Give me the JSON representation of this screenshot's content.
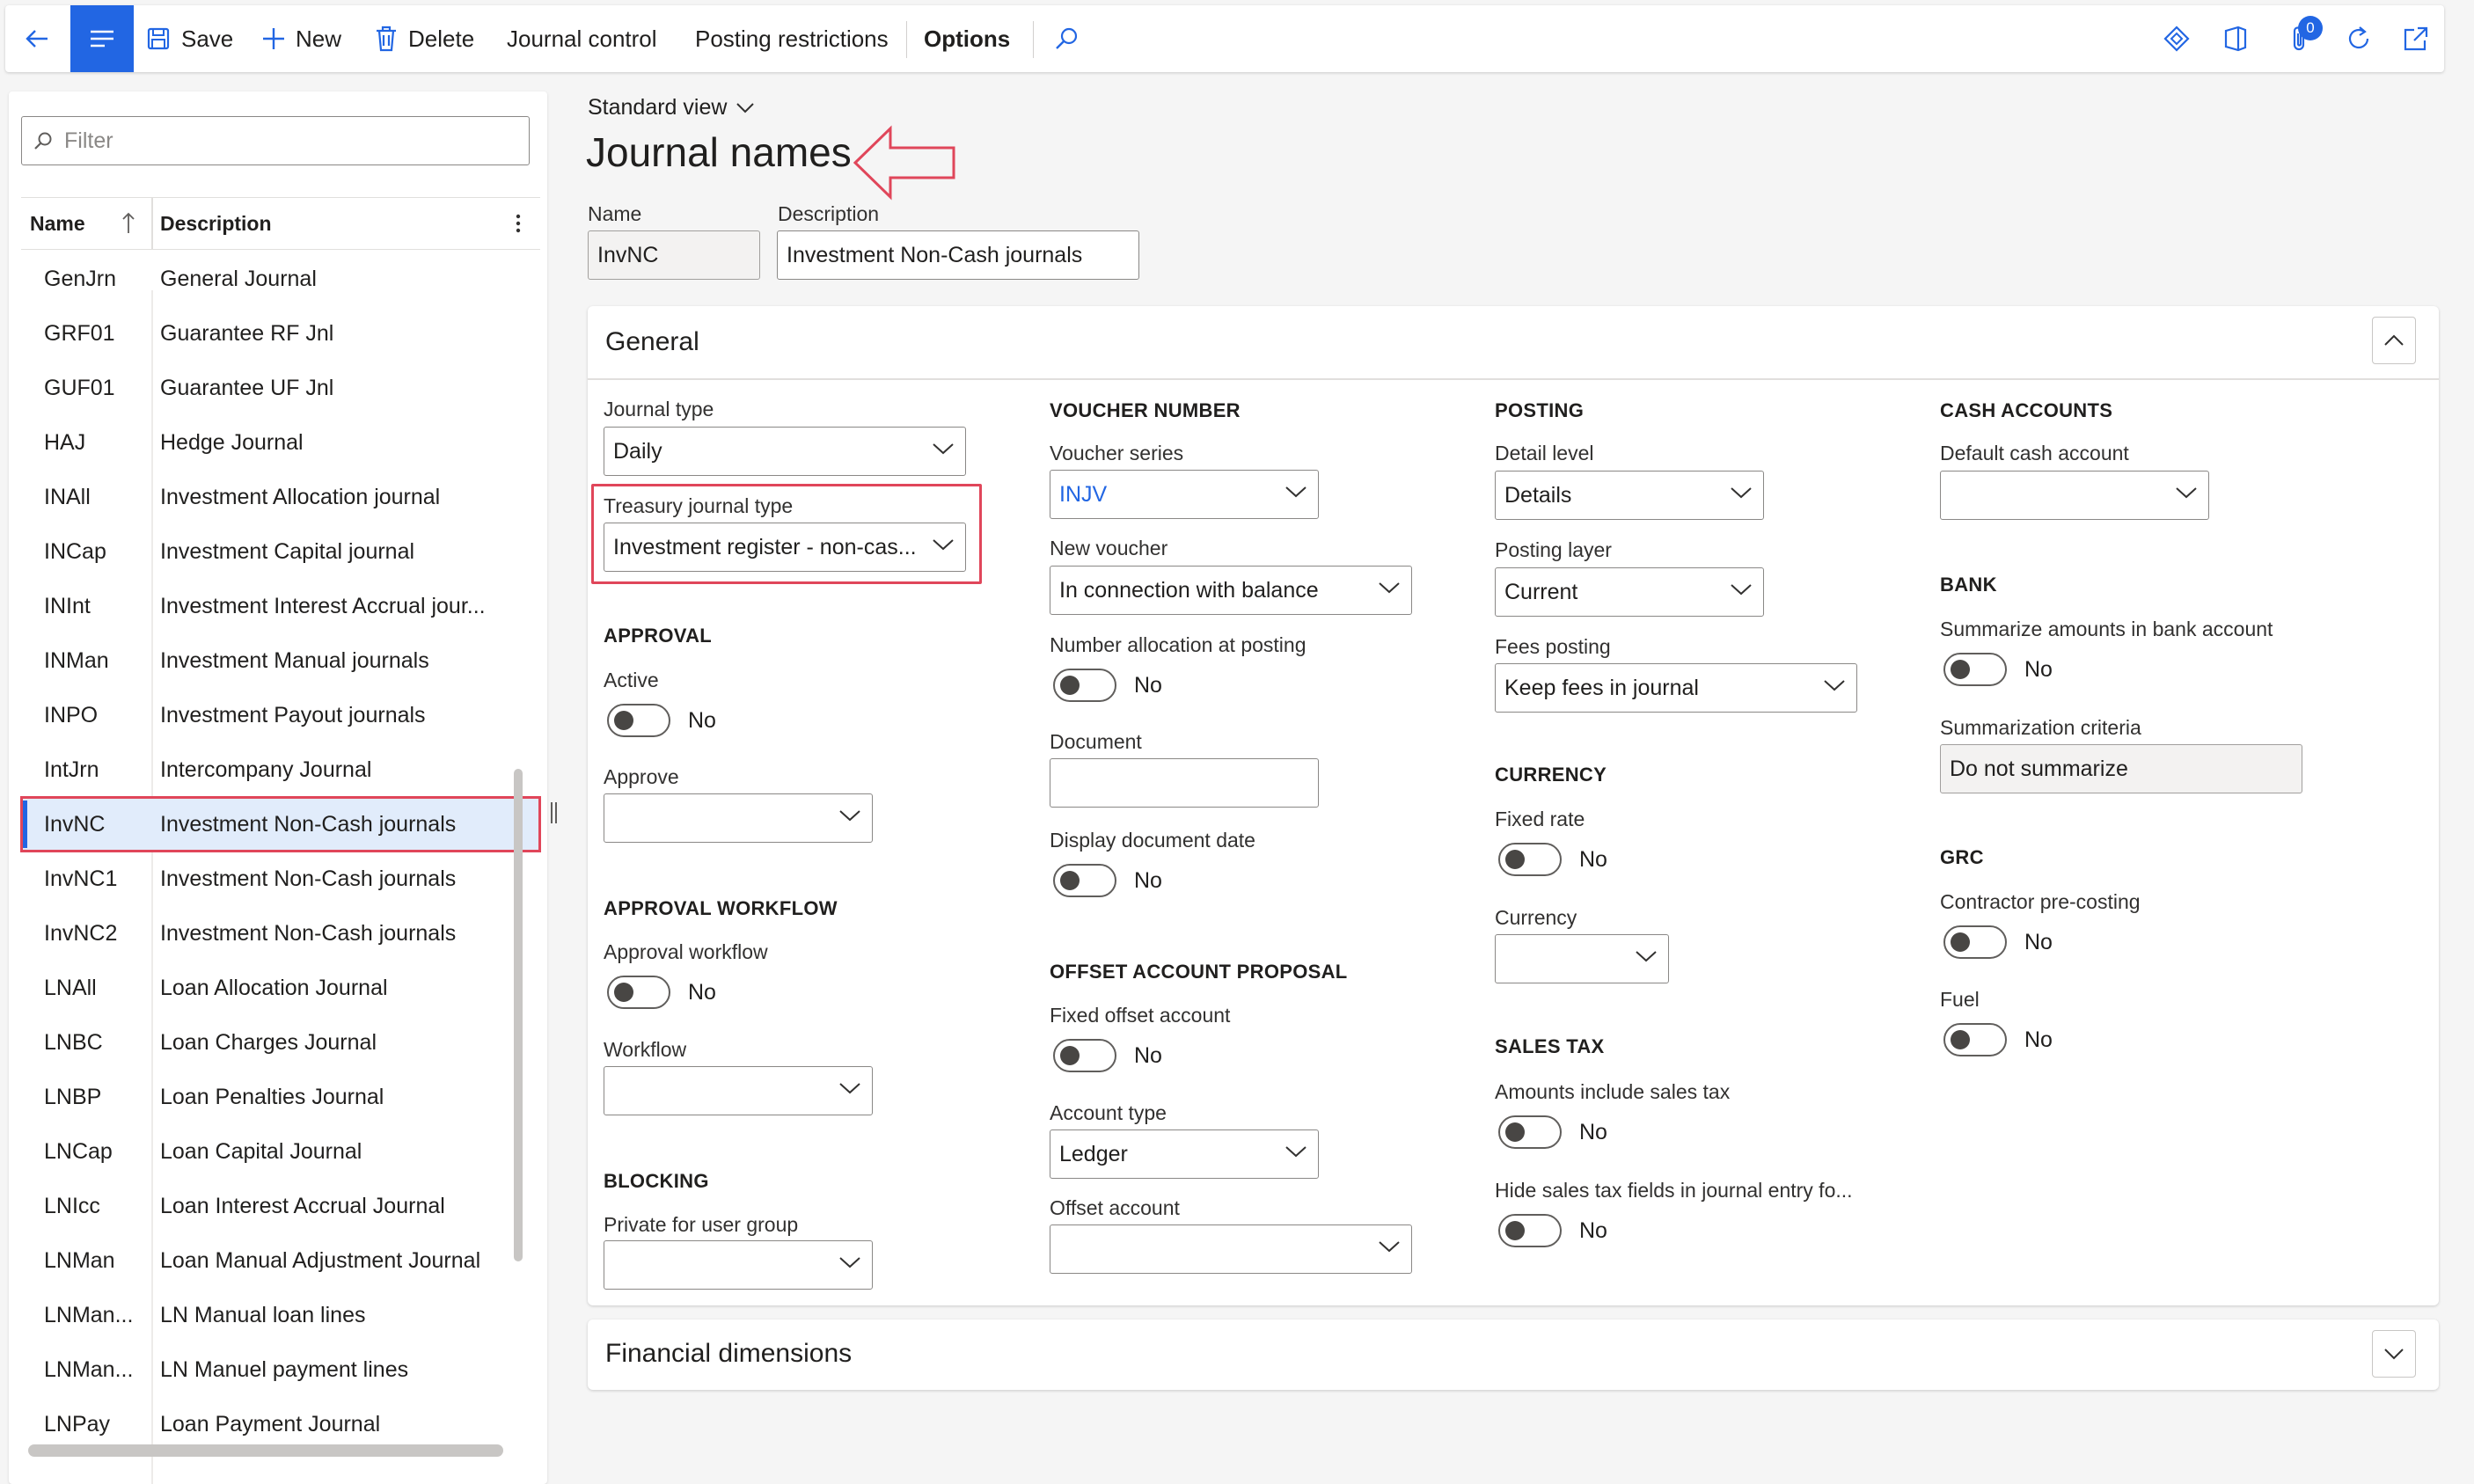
{
  "toolbar": {
    "save": "Save",
    "new": "New",
    "delete": "Delete",
    "journal_control": "Journal control",
    "posting_restrictions": "Posting restrictions",
    "options": "Options",
    "notifications_count": "0"
  },
  "list": {
    "filter_placeholder": "Filter",
    "col_name": "Name",
    "col_description": "Description",
    "rows": [
      {
        "name": "GenJrn",
        "description": "General Journal"
      },
      {
        "name": "GRF01",
        "description": "Guarantee RF Jnl"
      },
      {
        "name": "GUF01",
        "description": "Guarantee UF Jnl"
      },
      {
        "name": "HAJ",
        "description": "Hedge Journal"
      },
      {
        "name": "INAll",
        "description": "Investment Allocation journal"
      },
      {
        "name": "INCap",
        "description": "Investment Capital journal"
      },
      {
        "name": "INInt",
        "description": "Investment Interest Accrual jour..."
      },
      {
        "name": "INMan",
        "description": "Investment Manual journals"
      },
      {
        "name": "INPO",
        "description": "Investment Payout journals"
      },
      {
        "name": "IntJrn",
        "description": "Intercompany Journal"
      },
      {
        "name": "InvNC",
        "description": "Investment Non-Cash journals"
      },
      {
        "name": "InvNC1",
        "description": "Investment Non-Cash journals"
      },
      {
        "name": "InvNC2",
        "description": "Investment Non-Cash journals"
      },
      {
        "name": "LNAll",
        "description": "Loan Allocation Journal"
      },
      {
        "name": "LNBC",
        "description": "Loan Charges Journal"
      },
      {
        "name": "LNBP",
        "description": "Loan Penalties Journal"
      },
      {
        "name": "LNCap",
        "description": "Loan Capital Journal"
      },
      {
        "name": "LNIcc",
        "description": "Loan Interest Accrual Journal"
      },
      {
        "name": "LNMan",
        "description": "Loan Manual Adjustment Journal"
      },
      {
        "name": "LNMan...",
        "description": "LN Manual loan lines"
      },
      {
        "name": "LNMan...",
        "description": "LN Manuel payment lines"
      },
      {
        "name": "LNPay",
        "description": "Loan Payment Journal"
      }
    ],
    "selected_index": 10
  },
  "header": {
    "view": "Standard view",
    "title": "Journal names",
    "name_label": "Name",
    "name_value": "InvNC",
    "description_label": "Description",
    "description_value": "Investment Non-Cash journals"
  },
  "general": {
    "title": "General",
    "journal_type_label": "Journal type",
    "journal_type_value": "Daily",
    "treasury_type_label": "Treasury journal type",
    "treasury_type_value": "Investment register - non-cas...",
    "approval_group": "APPROVAL",
    "active_label": "Active",
    "active_value": "No",
    "approve_label": "Approve",
    "approve_value": "",
    "approval_workflow_group": "APPROVAL WORKFLOW",
    "approval_workflow_label": "Approval workflow",
    "approval_workflow_value": "No",
    "workflow_label": "Workflow",
    "workflow_value": "",
    "blocking_group": "BLOCKING",
    "private_label": "Private for user group",
    "private_value": "",
    "voucher_group": "VOUCHER NUMBER",
    "voucher_series_label": "Voucher series",
    "voucher_series_value": "INJV",
    "new_voucher_label": "New voucher",
    "new_voucher_value": "In connection with balance",
    "number_alloc_label": "Number allocation at posting",
    "number_alloc_value": "No",
    "document_label": "Document",
    "document_value": "",
    "display_doc_date_label": "Display document date",
    "display_doc_date_value": "No",
    "offset_group": "OFFSET ACCOUNT PROPOSAL",
    "fixed_offset_label": "Fixed offset account",
    "fixed_offset_value": "No",
    "account_type_label": "Account type",
    "account_type_value": "Ledger",
    "offset_account_label": "Offset account",
    "offset_account_value": "",
    "posting_group": "POSTING",
    "detail_level_label": "Detail level",
    "detail_level_value": "Details",
    "posting_layer_label": "Posting layer",
    "posting_layer_value": "Current",
    "fees_posting_label": "Fees posting",
    "fees_posting_value": "Keep fees in journal",
    "currency_group": "CURRENCY",
    "fixed_rate_label": "Fixed rate",
    "fixed_rate_value": "No",
    "currency_label": "Currency",
    "currency_value": "",
    "sales_tax_group": "SALES TAX",
    "amounts_tax_label": "Amounts include sales tax",
    "amounts_tax_value": "No",
    "hide_tax_label": "Hide sales tax fields in journal entry fo...",
    "hide_tax_value": "No",
    "cash_group": "CASH ACCOUNTS",
    "default_cash_label": "Default cash account",
    "default_cash_value": "",
    "bank_group": "BANK",
    "summarize_label": "Summarize amounts in bank account",
    "summarize_value": "No",
    "summ_criteria_label": "Summarization criteria",
    "summ_criteria_value": "Do not summarize",
    "grc_group": "GRC",
    "contractor_label": "Contractor pre-costing",
    "contractor_value": "No",
    "fuel_label": "Fuel",
    "fuel_value": "No"
  },
  "financial": {
    "title": "Financial dimensions"
  },
  "colors": {
    "accent": "#2266e3",
    "annotation_red": "#e0465a",
    "selected_row": "#e1ecfb"
  }
}
